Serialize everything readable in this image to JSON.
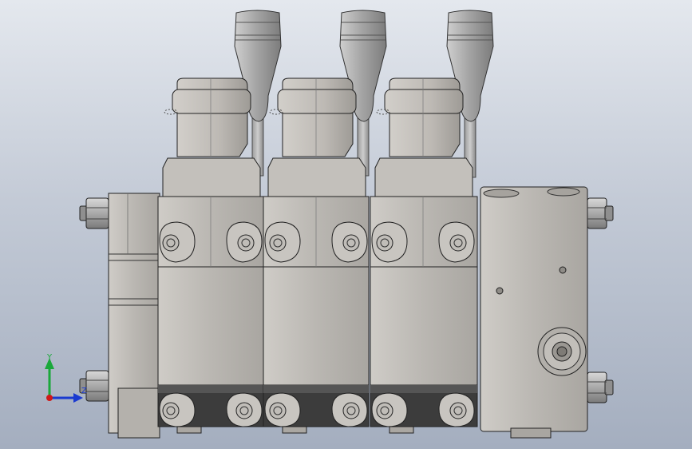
{
  "viewport": {
    "background_top": "#e4e8ee",
    "background_bottom": "#a4aebf"
  },
  "model": {
    "spool_sections": 3,
    "body_color": "#b9b6b1",
    "body_shade": "#a8a5a0",
    "dark_band_color": "#3a3a3a",
    "edge_color": "#202020",
    "handle_color": "#9a9a9a"
  },
  "triad": {
    "y_label": "Y",
    "z_label": "Z",
    "y_color": "#1aa83a",
    "x_color": "#d01818",
    "z_color": "#1a3ad0"
  }
}
